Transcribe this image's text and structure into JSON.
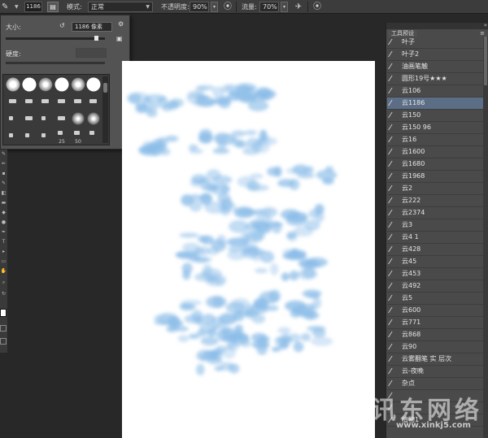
{
  "options_bar": {
    "size_value": "1186",
    "brush_panel_icon_text": "▤",
    "mode_label": "模式:",
    "mode_value": "正常",
    "opacity_label": "不透明度:",
    "opacity_value": "90%",
    "flow_label": "流量:",
    "flow_value": "70%"
  },
  "brush_popup": {
    "size_label": "大小:",
    "size_value": "1186 像素",
    "size_fraction": 0.93,
    "hardness_label": "硬度:",
    "thumb_numbers": [
      "25",
      "50"
    ]
  },
  "right_panel": {
    "tab_label": "工具预设",
    "items": [
      {
        "label": "叶子",
        "selected": false
      },
      {
        "label": "叶子2",
        "selected": false
      },
      {
        "label": "油画笔触",
        "selected": false
      },
      {
        "label": "圆形19号★★★",
        "selected": false
      },
      {
        "label": "云106",
        "selected": false
      },
      {
        "label": "云1186",
        "selected": true
      },
      {
        "label": "云150",
        "selected": false
      },
      {
        "label": "云150 96",
        "selected": false
      },
      {
        "label": "云16",
        "selected": false
      },
      {
        "label": "云1600",
        "selected": false
      },
      {
        "label": "云1680",
        "selected": false
      },
      {
        "label": "云1968",
        "selected": false
      },
      {
        "label": "云2",
        "selected": false
      },
      {
        "label": "云222",
        "selected": false
      },
      {
        "label": "云2374",
        "selected": false
      },
      {
        "label": "云3",
        "selected": false
      },
      {
        "label": "云4 1",
        "selected": false
      },
      {
        "label": "云428",
        "selected": false
      },
      {
        "label": "云45",
        "selected": false
      },
      {
        "label": "云453",
        "selected": false
      },
      {
        "label": "云492",
        "selected": false
      },
      {
        "label": "云5",
        "selected": false
      },
      {
        "label": "云600",
        "selected": false
      },
      {
        "label": "云771",
        "selected": false
      },
      {
        "label": "云868",
        "selected": false
      },
      {
        "label": "云90",
        "selected": false
      },
      {
        "label": "云雾翻笔 实 层次",
        "selected": false
      },
      {
        "label": "云-夜晚",
        "selected": false
      },
      {
        "label": "杂点",
        "selected": false
      },
      {
        "label": "",
        "selected": false
      },
      {
        "label": "",
        "selected": false
      },
      {
        "label": "植物1",
        "selected": false
      }
    ]
  },
  "watermark": {
    "text": "讯东网络",
    "url": "www.xinkj5.com"
  },
  "colors": {
    "accent_selected": "#5b6e86",
    "cloud_blue": "#8cbde8"
  }
}
